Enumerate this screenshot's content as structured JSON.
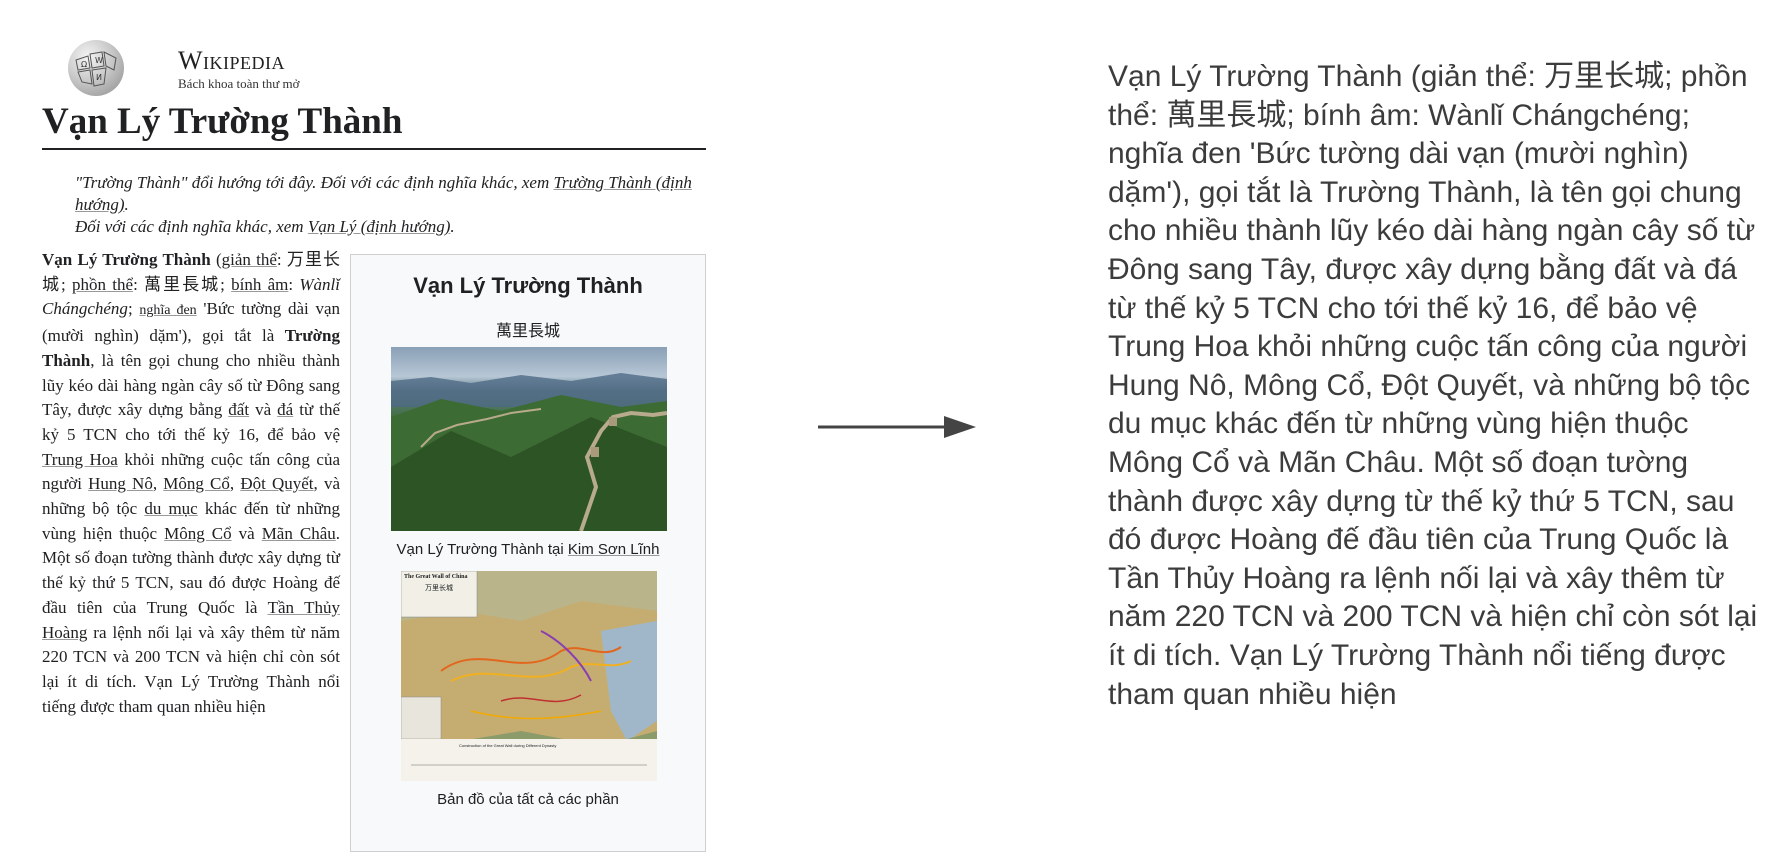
{
  "wiki": {
    "site_name": "Wikipedia",
    "tagline": "Bách khoa toàn thư mở",
    "title": "Vạn Lý Trường Thành",
    "hatnote1_a": "\"Trường Thành\" đổi hướng tới đây. Đối với các định nghĩa khác, xem ",
    "hatnote1_link": "Trường Thành (định hướng)",
    "hatnote1_b": ".",
    "hatnote2_a": "Đối với các định nghĩa khác, xem ",
    "hatnote2_link": "Vạn Lý (định hướng)",
    "hatnote2_b": "."
  },
  "body": {
    "t1": "Vạn Lý Trường Thành",
    "t2": " (",
    "t3": "giản thể",
    "t4": ": 万里长城; ",
    "t5": "phồn thể",
    "t6": ": 萬里長城; ",
    "t7": "bính âm",
    "t8": ": ",
    "t9": "Wànlǐ Chángchéng",
    "t10": "; ",
    "t11": "nghĩa đen",
    "t12": " 'Bức tường dài vạn (mười nghìn) dặm'), gọi tắt là ",
    "t13": "Trường Thành",
    "t14": ", là tên gọi chung cho nhiều thành lũy kéo dài hàng ngàn cây số từ Đông sang Tây, được xây dựng bằng ",
    "t15": "đất",
    "t16": " và ",
    "t17": "đá",
    "t18": " từ thế kỷ 5 TCN cho tới thế kỷ 16, để bảo vệ ",
    "t19": "Trung Hoa",
    "t20": " khỏi những cuộc tấn công của người ",
    "t21": "Hung Nô",
    "t22": ", ",
    "t23": "Mông Cổ",
    "t24": ", ",
    "t25": "Đột Quyết",
    "t26": ", và những bộ tộc ",
    "t27": "du mục",
    "t28": " khác đến từ những vùng hiện thuộc ",
    "t29": "Mông Cổ",
    "t30": " và ",
    "t31": "Mãn Châu",
    "t32": ". Một số đoạn tường thành được xây dựng từ thế kỷ thứ 5 TCN, sau đó được Hoàng đế đầu tiên của Trung Quốc là ",
    "t33": "Tần Thủy Hoàng",
    "t34": " ra lệnh nối lại và xây thêm từ năm 220 TCN và 200 TCN và hiện chỉ còn sót lại ít di tích. Vạn Lý Trường Thành nổi tiếng được tham quan nhiều hiện"
  },
  "infobox": {
    "title": "Vạn Lý Trường Thành",
    "subtitle": "萬里長城",
    "caption1_a": "Vạn Lý Trường Thành tại ",
    "caption1_link": "Kim Sơn Lĩnh",
    "map_title": "The Great Wall of China",
    "map_subtitle": "万里长城",
    "map_footer": "Construction of the Great Wall during Different Dynasty",
    "caption2": "Bản đồ của tất cả các phần"
  },
  "extracted_text": "Vạn Lý Trường Thành (giản thể: 万里长城; phồn thể: 萬里長城; bính âm: Wànlǐ Chángchéng; nghĩa đen 'Bức tường dài vạn (mười nghìn) dặm'), gọi tắt là Trường Thành, là tên gọi chung cho nhiều thành lũy kéo dài hàng ngàn cây số từ Đông sang Tây, được xây dựng bằng đất và đá từ thế kỷ 5 TCN cho tới thế kỷ 16, để bảo vệ Trung Hoa khỏi những cuộc tấn công của người Hung Nô, Mông Cổ, Đột Quyết, và những bộ tộc du mục khác đến từ những vùng hiện thuộc Mông Cổ và Mãn Châu. Một số đoạn tường thành được xây dựng từ thế kỷ thứ 5 TCN, sau đó được Hoàng đế đầu tiên của Trung Quốc là Tần Thủy Hoàng ra lệnh nối lại và xây thêm từ năm 220 TCN và 200 TCN và hiện chỉ còn sót lại ít di tích. Vạn Lý Trường Thành nổi tiếng được tham quan nhiều hiện",
  "colors": {
    "text": "#202122",
    "arrow": "#444444",
    "extracted_text": "#3c3c3c"
  },
  "icons": [
    "wikipedia-globe-logo",
    "right-arrow-icon"
  ]
}
